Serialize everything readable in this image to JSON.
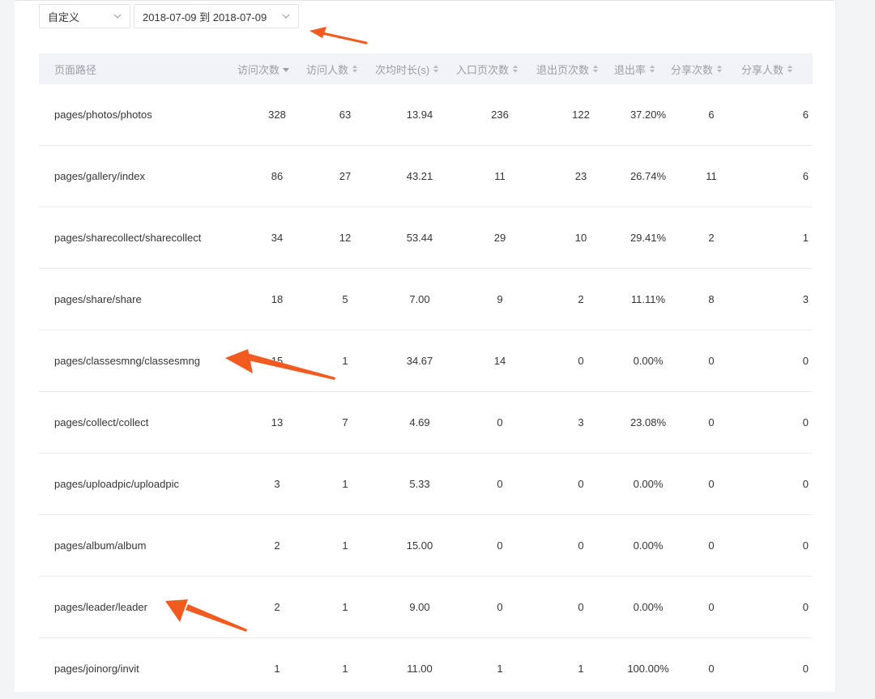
{
  "filters": {
    "type_value": "自定义",
    "date_range_value": "2018-07-09 到 2018-07-09"
  },
  "table": {
    "headers": [
      "页面路径",
      "访问次数",
      "访问人数",
      "次均时长(s)",
      "入口页次数",
      "退出页次数",
      "退出率",
      "分享次数",
      "分享人数"
    ],
    "rows": [
      [
        "pages/photos/photos",
        "328",
        "63",
        "13.94",
        "236",
        "122",
        "37.20%",
        "6",
        "6"
      ],
      [
        "pages/gallery/index",
        "86",
        "27",
        "43.21",
        "11",
        "23",
        "26.74%",
        "11",
        "6"
      ],
      [
        "pages/sharecollect/sharecollect",
        "34",
        "12",
        "53.44",
        "29",
        "10",
        "29.41%",
        "2",
        "1"
      ],
      [
        "pages/share/share",
        "18",
        "5",
        "7.00",
        "9",
        "2",
        "11.11%",
        "8",
        "3"
      ],
      [
        "pages/classesmng/classesmng",
        "15",
        "1",
        "34.67",
        "14",
        "0",
        "0.00%",
        "0",
        "0"
      ],
      [
        "pages/collect/collect",
        "13",
        "7",
        "4.69",
        "0",
        "3",
        "23.08%",
        "0",
        "0"
      ],
      [
        "pages/uploadpic/uploadpic",
        "3",
        "1",
        "5.33",
        "0",
        "0",
        "0.00%",
        "0",
        "0"
      ],
      [
        "pages/album/album",
        "2",
        "1",
        "15.00",
        "0",
        "0",
        "0.00%",
        "0",
        "0"
      ],
      [
        "pages/leader/leader",
        "2",
        "1",
        "9.00",
        "0",
        "0",
        "0.00%",
        "0",
        "0"
      ],
      [
        "pages/joinorg/invit",
        "1",
        "1",
        "11.00",
        "1",
        "1",
        "100.00%",
        "0",
        "0"
      ]
    ]
  },
  "colors": {
    "accent_arrow": "#f25a1f",
    "header_bg": "#f1f3f6",
    "header_text": "#9a9ea6",
    "body_text": "#353535"
  },
  "icons": {
    "dropdown": "chevron-down-icon",
    "sort_desc": "sort-desc-icon",
    "sort_both": "sort-both-icon"
  }
}
